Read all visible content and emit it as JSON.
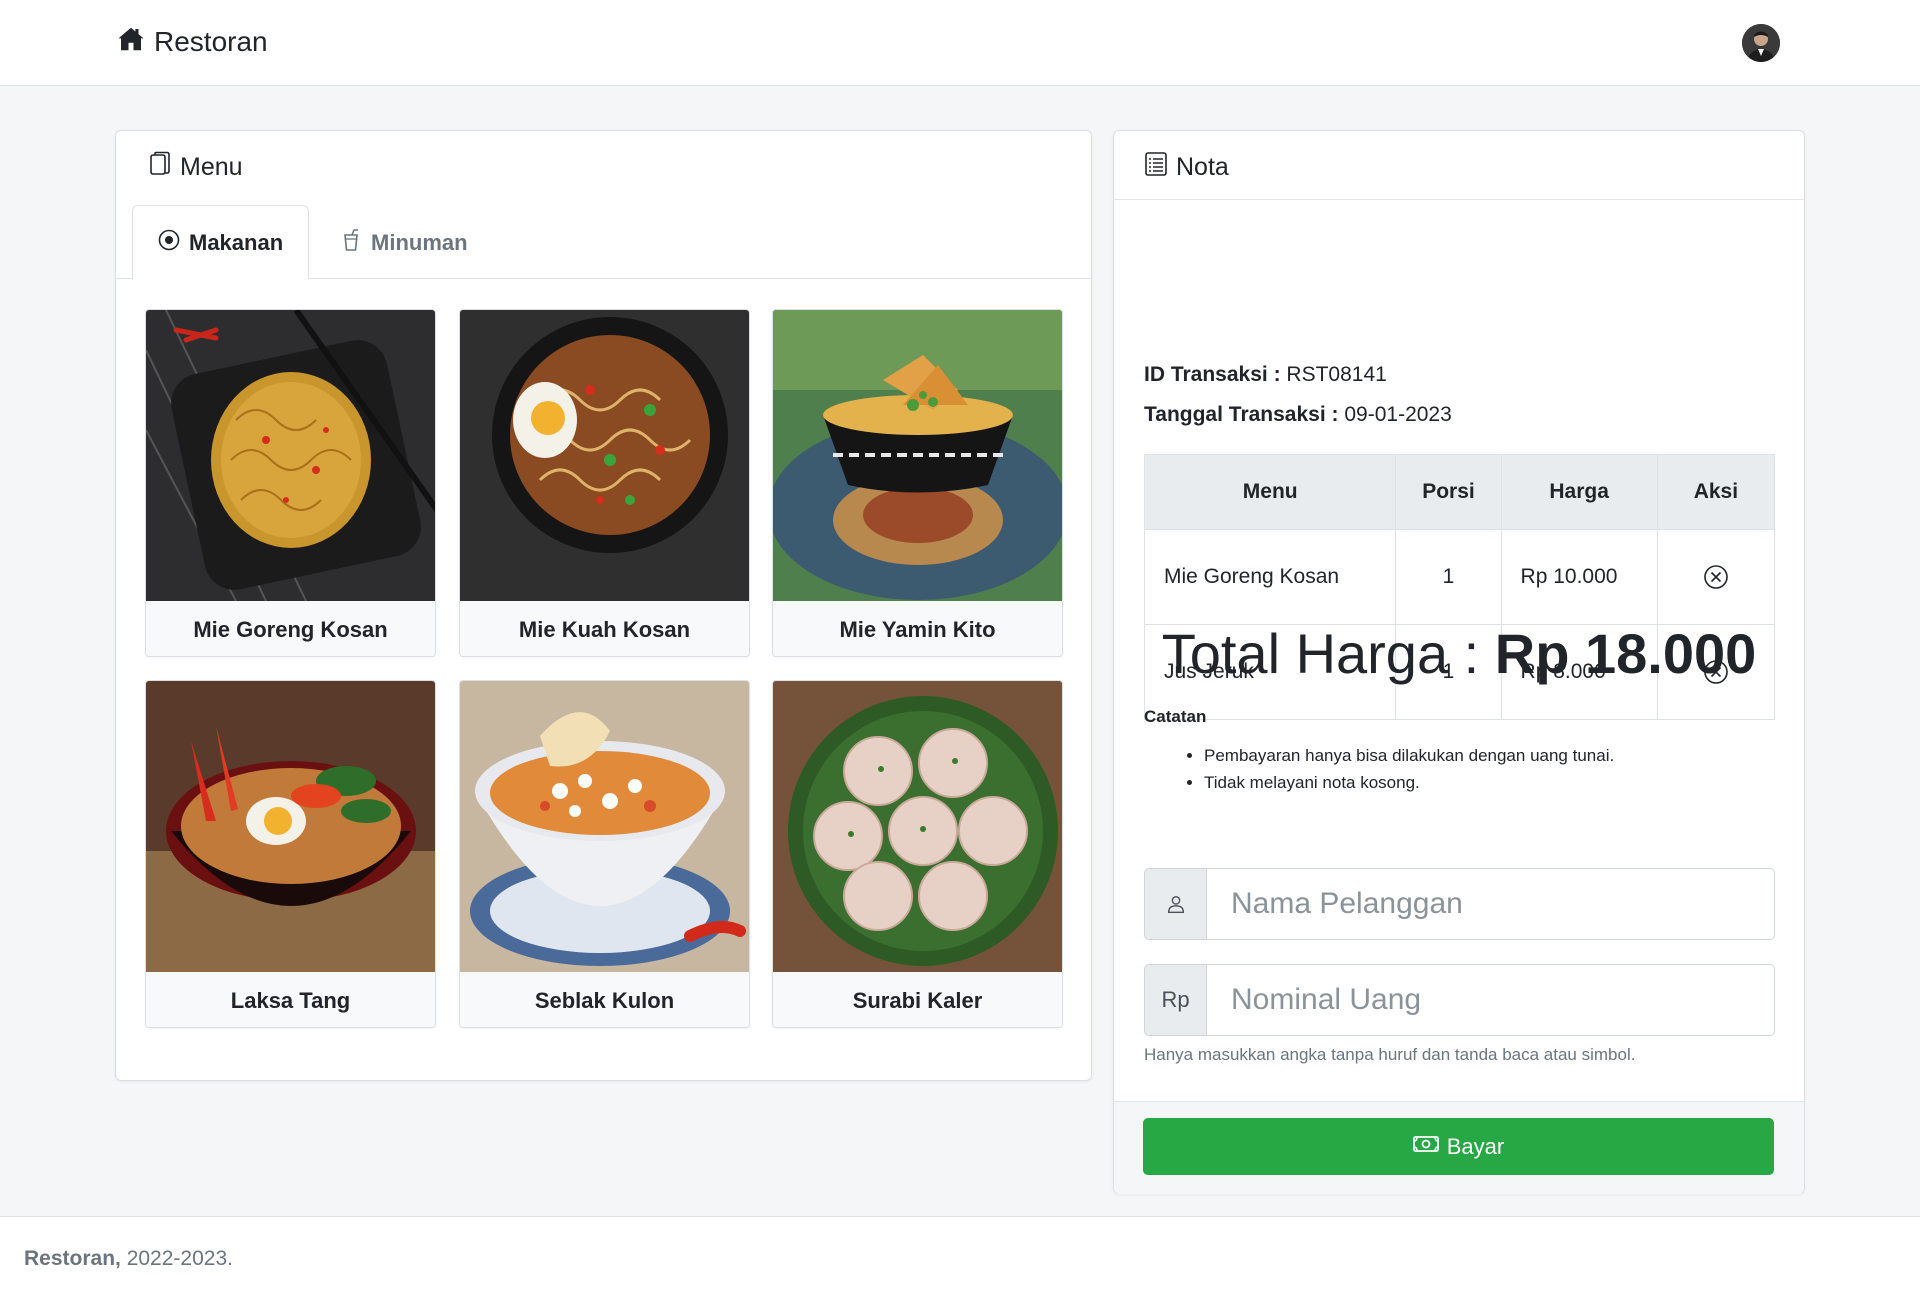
{
  "navbar": {
    "brand": "Restoran",
    "brand_icon": "house-icon",
    "avatar": "user-avatar"
  },
  "menu": {
    "title": "Menu",
    "tabs": [
      {
        "label": "Makanan",
        "icon": "food-icon",
        "active": true
      },
      {
        "label": "Minuman",
        "icon": "cup-icon",
        "active": false
      }
    ],
    "items": [
      {
        "name": "Mie Goreng Kosan"
      },
      {
        "name": "Mie Kuah Kosan"
      },
      {
        "name": "Mie Yamin Kito"
      },
      {
        "name": "Laksa Tang"
      },
      {
        "name": "Seblak Kulon"
      },
      {
        "name": "Surabi Kaler"
      }
    ]
  },
  "nota": {
    "title": "Nota",
    "id_label": "ID Transaksi :",
    "id_value": "RST08141",
    "date_label": "Tanggal Transaksi :",
    "date_value": "09-01-2023",
    "columns": [
      "Menu",
      "Porsi",
      "Harga",
      "Aksi"
    ],
    "rows": [
      {
        "menu": "Mie Goreng Kosan",
        "porsi": "1",
        "harga": "Rp 10.000"
      },
      {
        "menu": "Jus Jeruk",
        "porsi": "1",
        "harga": "Rp 8.000"
      }
    ],
    "total_label": "Total Harga :",
    "total_value": "Rp 18.000",
    "catatan_title": "Catatan",
    "catatan": [
      "Pembayaran hanya bisa dilakukan dengan uang tunai.",
      "Tidak melayani nota kosong."
    ],
    "name_placeholder": "Nama Pelanggan",
    "money_addon": "Rp",
    "money_placeholder": "Nominal Uang",
    "help_text": "Hanya masukkan angka tanpa huruf dan tanda baca atau simbol.",
    "pay_label": "Bayar",
    "pay_color": "#28a745"
  },
  "footer": {
    "brand": "Restoran,",
    "years": " 2022-2023."
  }
}
